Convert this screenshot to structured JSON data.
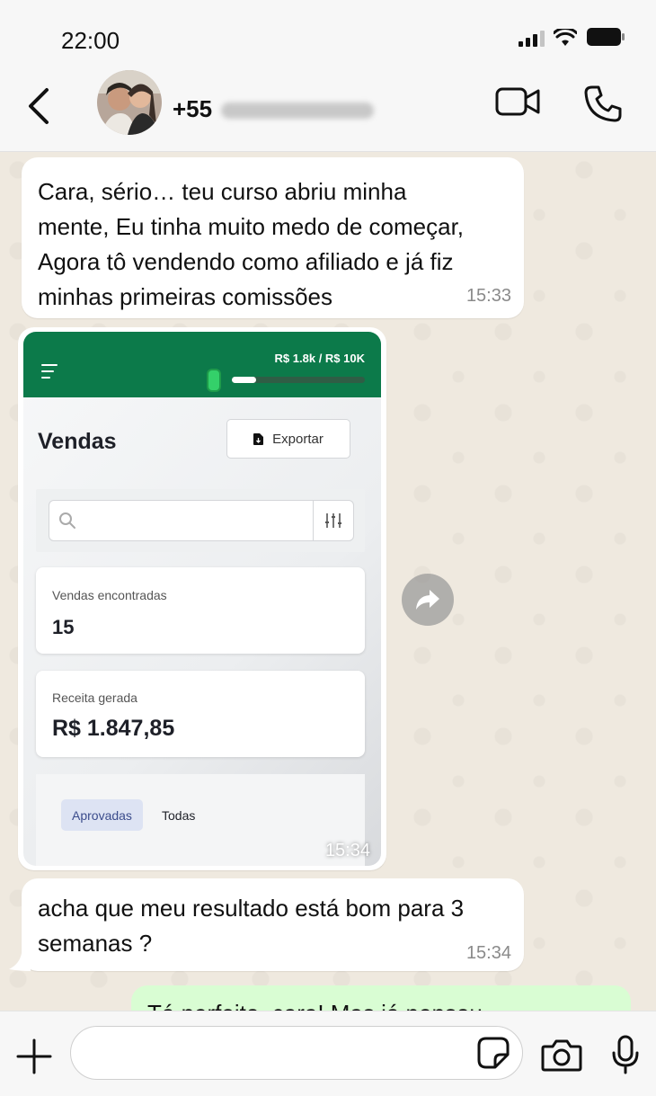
{
  "status_bar": {
    "time": "22:00"
  },
  "header": {
    "contact_prefix": "+55"
  },
  "messages": [
    {
      "lines": [
        "Cara, sério… teu curso abriu minha",
        "mente, Eu tinha muito medo de começar,",
        "Agora tô vendendo como afiliado e já fiz",
        "minhas primeiras comissões"
      ],
      "time": "15:33"
    },
    {
      "media": {
        "goal_text": "R$ 1.8k / R$ 10K",
        "goal_progress": 0.18,
        "title": "Vendas",
        "export_label": "Exportar",
        "cards": [
          {
            "label": "Vendas encontradas",
            "value": "15"
          },
          {
            "label": "Receita gerada",
            "value": "R$ 1.847,85"
          }
        ],
        "filters": [
          "Aprovadas",
          "Todas"
        ],
        "active_filter": "Aprovadas"
      },
      "time": "15:34"
    },
    {
      "lines": [
        "acha que meu resultado está bom para 3",
        "semanas ?"
      ],
      "time": "15:34"
    },
    {
      "partial_text": "Tá perfeito, cara! Mas já pensou",
      "outgoing": true
    }
  ]
}
